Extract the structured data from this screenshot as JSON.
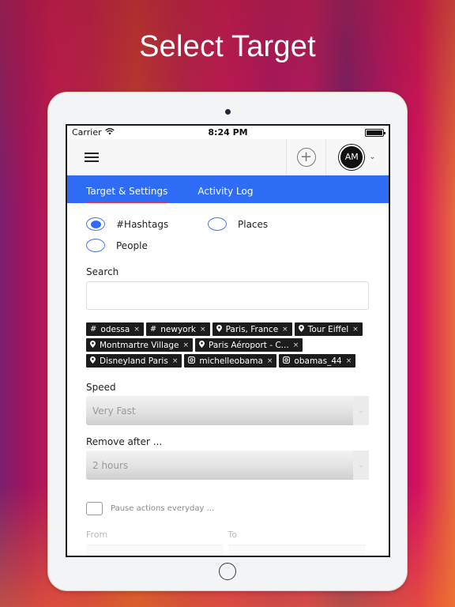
{
  "headline": "Select Target",
  "statusbar": {
    "carrier": "Carrier",
    "time": "8:24 PM",
    "wifi_icon": "wifi-icon",
    "battery_icon": "battery-icon"
  },
  "appbar": {
    "menu_icon": "hamburger-menu-icon",
    "add_icon": "plus-circle-icon",
    "add_symbol": "+",
    "avatar_initials": "AM",
    "profile_chevron": "⌄"
  },
  "tabs": [
    {
      "label": "Target & Settings",
      "active": true
    },
    {
      "label": "Activity Log",
      "active": false
    }
  ],
  "target_type": {
    "options": [
      {
        "label": "#Hashtags",
        "selected": true
      },
      {
        "label": "Places",
        "selected": false
      },
      {
        "label": "People",
        "selected": false
      }
    ]
  },
  "search": {
    "label": "Search",
    "value": "",
    "placeholder": ""
  },
  "chips": [
    {
      "type": "hashtag",
      "icon": "#",
      "label": "odessa"
    },
    {
      "type": "hashtag",
      "icon": "#",
      "label": "newyork"
    },
    {
      "type": "place",
      "icon": "📍",
      "label": "Paris, France"
    },
    {
      "type": "place",
      "icon": "📍",
      "label": "Tour Eiffel"
    },
    {
      "type": "place",
      "icon": "📍",
      "label": "Montmartre Village"
    },
    {
      "type": "place",
      "icon": "📍",
      "label": "Paris Aéroport - C..."
    },
    {
      "type": "place",
      "icon": "📍",
      "label": "Disneyland Paris"
    },
    {
      "type": "person",
      "icon": "◎",
      "label": "michelleobama"
    },
    {
      "type": "person",
      "icon": "◎",
      "label": "obamas_44"
    }
  ],
  "chip_remove_symbol": "×",
  "speed": {
    "label": "Speed",
    "value": "Very Fast"
  },
  "remove_after": {
    "label": "Remove after ...",
    "value": "2 hours"
  },
  "select_arrow": "⌄",
  "pause": {
    "label": "Pause actions everyday ...",
    "checked": false
  },
  "schedule": {
    "from_label": "From",
    "to_label": "To"
  },
  "colors": {
    "accent_blue": "#2f6cf6",
    "tab_underline": "#e8343a",
    "chip_bg": "#1c1c1c"
  }
}
